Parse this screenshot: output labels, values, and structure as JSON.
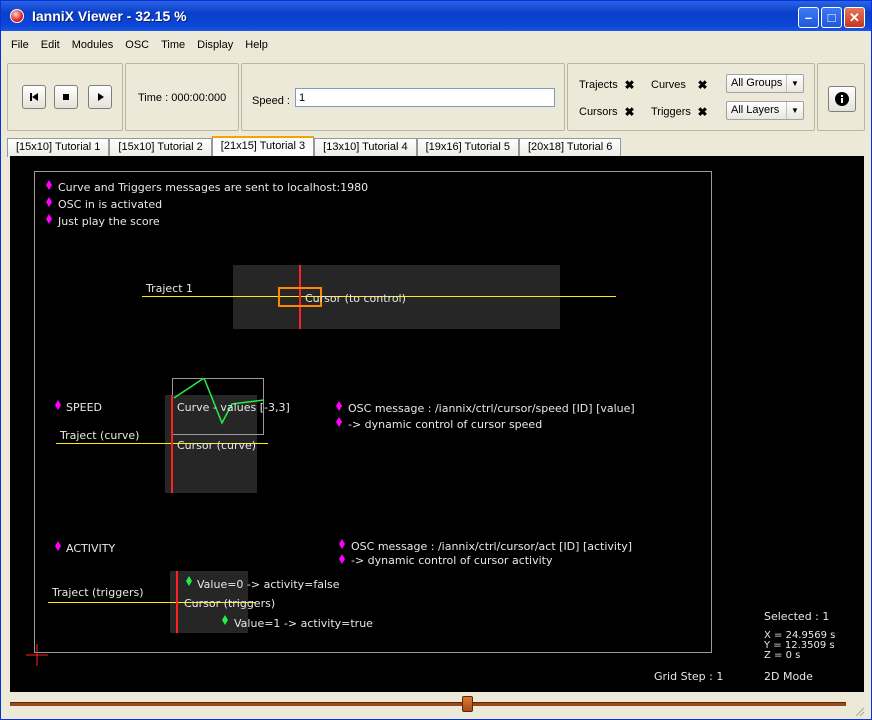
{
  "window": {
    "title": "IanniX Viewer - 32.15 %"
  },
  "menu": [
    "File",
    "Edit",
    "Modules",
    "OSC",
    "Time",
    "Display",
    "Help"
  ],
  "toolbar": {
    "time_label": "Time : 000:00:000",
    "speed_label": "Speed :",
    "speed_value": "1",
    "trajects_label": "Trajects",
    "curves_label": "Curves",
    "cursors_label": "Cursors",
    "triggers_label": "Triggers",
    "groups_select": "All Groups",
    "layers_select": "All Layers"
  },
  "tabs": [
    "[15x10] Tutorial 1",
    "[15x10] Tutorial 2",
    "[21x15] Tutorial 3",
    "[13x10] Tutorial 4",
    "[19x16] Tutorial 5",
    "[20x18] Tutorial 6"
  ],
  "active_tab": 2,
  "score": {
    "intro": [
      "Curve and Triggers messages are sent to localhost:1980",
      "OSC in is activated",
      "Just play the score"
    ],
    "traject1": "Traject 1",
    "cursor_control": "Cursor (to control)",
    "speed_heading": "SPEED",
    "curve_values": "Curve - values [-3,3]",
    "traject_curve": "Traject (curve)",
    "cursor_curve": "Cursor (curve)",
    "speed_osc": "OSC message : /iannix/ctrl/cursor/speed [ID] [value]",
    "speed_desc": "-> dynamic control of cursor speed",
    "activity_heading": "ACTIVITY",
    "activity_osc": "OSC message : /iannix/ctrl/cursor/act [ID] [activity]",
    "activity_desc": "-> dynamic control of cursor activity",
    "traject_triggers": "Traject (triggers)",
    "cursor_triggers": "Cursor (triggers)",
    "trigger_false": "Value=0 -> activity=false",
    "trigger_true": "Value=1 -> activity=true"
  },
  "status": {
    "selected": "Selected : 1",
    "x": "X = 24.9569 s",
    "y": "Y = 12.3509 s",
    "z": "Z = 0 s",
    "grid_step": "Grid Step : 1",
    "mode": "2D Mode"
  },
  "colors": {
    "traject": "#ffee00",
    "cursor": "#ff2222",
    "curve": "#22ee44",
    "trigger_on": "#ff00ff",
    "selection": "#ff8800"
  }
}
